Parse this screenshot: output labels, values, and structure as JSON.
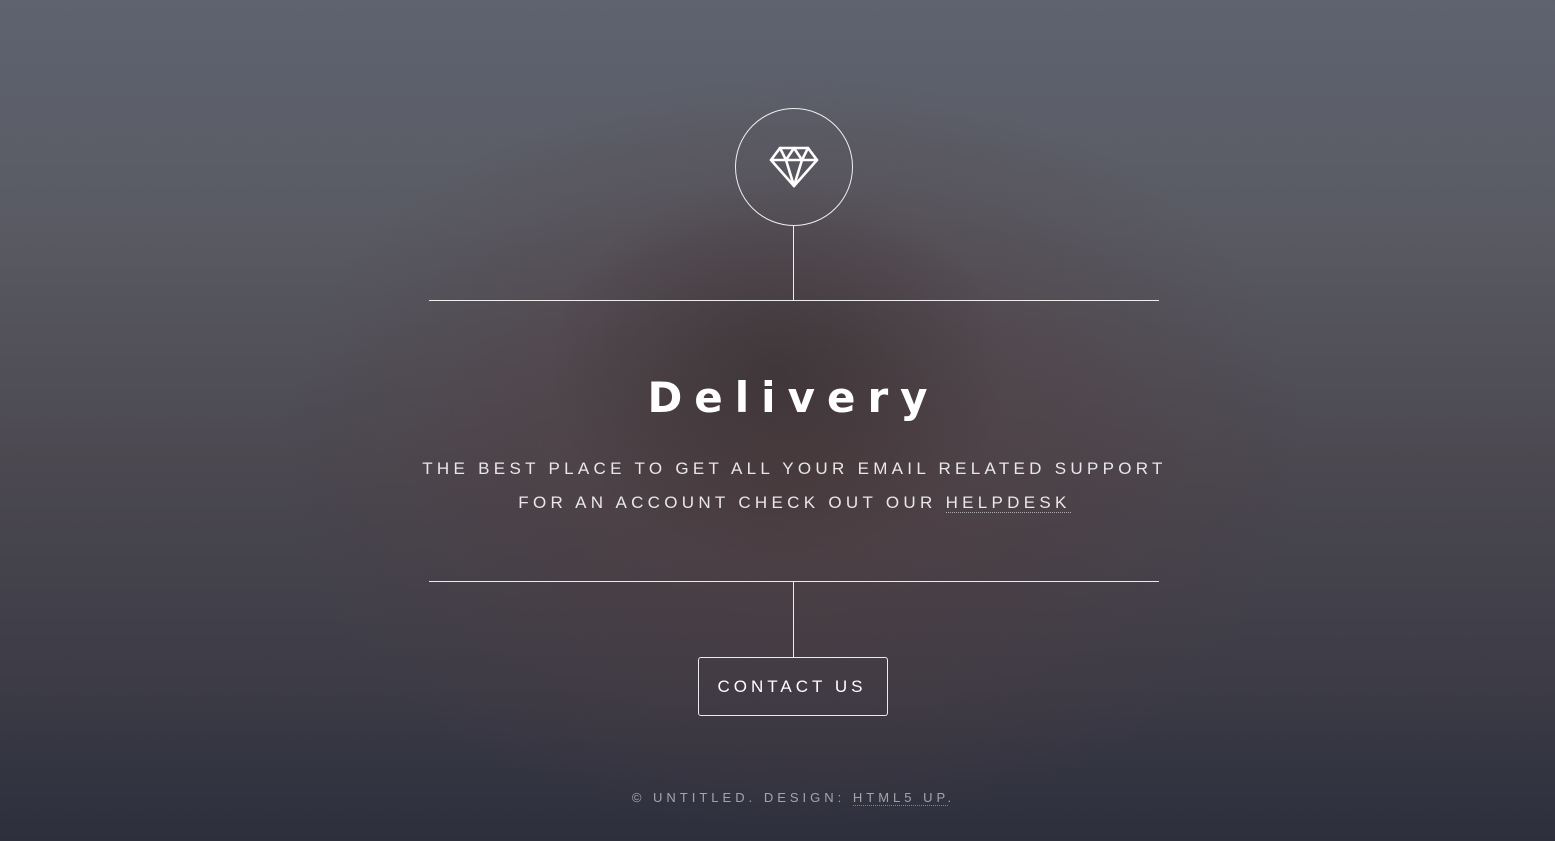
{
  "header": {
    "icon": "diamond-icon",
    "title": "Delivery"
  },
  "intro": {
    "line1": "The best place to get all your email related support",
    "line2_prefix": "for an account check out our ",
    "helpdesk_link": "Helpdesk"
  },
  "actions": {
    "contact_label": "Contact Us"
  },
  "footer": {
    "copyright": "© Untitled. Design: ",
    "credit_link": "HTML5 UP",
    "suffix": "."
  },
  "colors": {
    "text": "#ffffff",
    "background_top": "#5e6370",
    "background_bottom": "#2d2f3d"
  }
}
